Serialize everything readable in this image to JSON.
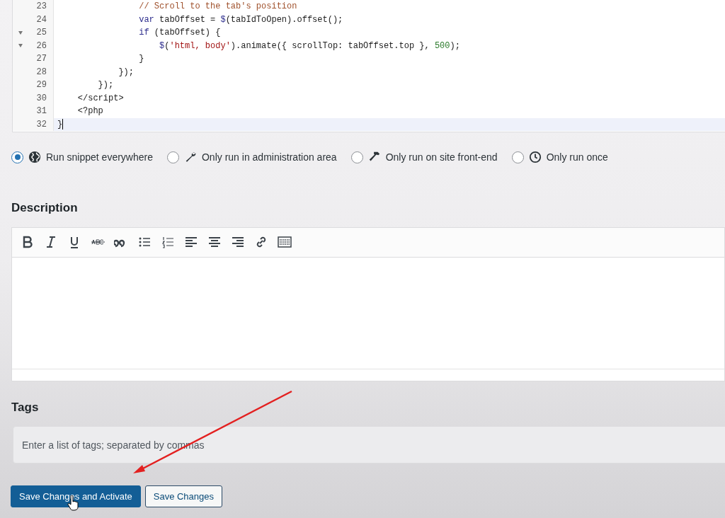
{
  "code_editor": {
    "lines": [
      {
        "number": "23",
        "foldable": false,
        "current": false,
        "tokens": [
          {
            "kind": "comment",
            "text": "                // Scroll to the tab's position"
          }
        ]
      },
      {
        "number": "24",
        "foldable": false,
        "current": false,
        "tokens": [
          {
            "kind": "keyword",
            "text": "                var"
          },
          {
            "kind": "plain",
            "text": " tabOffset = "
          },
          {
            "kind": "keyword",
            "text": "$"
          },
          {
            "kind": "plain",
            "text": "(tabIdToOpen).offset();"
          }
        ]
      },
      {
        "number": "25",
        "foldable": true,
        "current": false,
        "tokens": [
          {
            "kind": "keyword",
            "text": "                if"
          },
          {
            "kind": "plain",
            "text": " (tabOffset) {"
          }
        ]
      },
      {
        "number": "26",
        "foldable": true,
        "current": false,
        "tokens": [
          {
            "kind": "keyword",
            "text": "                    $"
          },
          {
            "kind": "plain",
            "text": "("
          },
          {
            "kind": "string",
            "text": "'html, body'"
          },
          {
            "kind": "plain",
            "text": ").animate({ scrollTop: tabOffset.top }, "
          },
          {
            "kind": "number",
            "text": "500"
          },
          {
            "kind": "plain",
            "text": ");"
          }
        ]
      },
      {
        "number": "27",
        "foldable": false,
        "current": false,
        "tokens": [
          {
            "kind": "plain",
            "text": "                }"
          }
        ]
      },
      {
        "number": "28",
        "foldable": false,
        "current": false,
        "tokens": [
          {
            "kind": "plain",
            "text": "            });"
          }
        ]
      },
      {
        "number": "29",
        "foldable": false,
        "current": false,
        "tokens": [
          {
            "kind": "plain",
            "text": "        });"
          }
        ]
      },
      {
        "number": "30",
        "foldable": false,
        "current": false,
        "tokens": [
          {
            "kind": "plain",
            "text": "    </script>"
          }
        ]
      },
      {
        "number": "31",
        "foldable": false,
        "current": false,
        "tokens": [
          {
            "kind": "plain",
            "text": "    <?php"
          }
        ]
      },
      {
        "number": "32",
        "foldable": false,
        "current": true,
        "tokens": [
          {
            "kind": "plain",
            "text": "}"
          }
        ]
      }
    ]
  },
  "scope_options": [
    {
      "label": "Run snippet everywhere",
      "selected": true
    },
    {
      "label": "Only run in administration area",
      "selected": false
    },
    {
      "label": "Only run on site front-end",
      "selected": false
    },
    {
      "label": "Only run once",
      "selected": false
    }
  ],
  "description": {
    "heading": "Description"
  },
  "tags": {
    "heading": "Tags",
    "placeholder": "Enter a list of tags; separated by commas"
  },
  "buttons": [
    {
      "label": "Save Changes and Activate",
      "kind": "primary"
    },
    {
      "label": "Save Changes",
      "kind": "secondary"
    }
  ]
}
